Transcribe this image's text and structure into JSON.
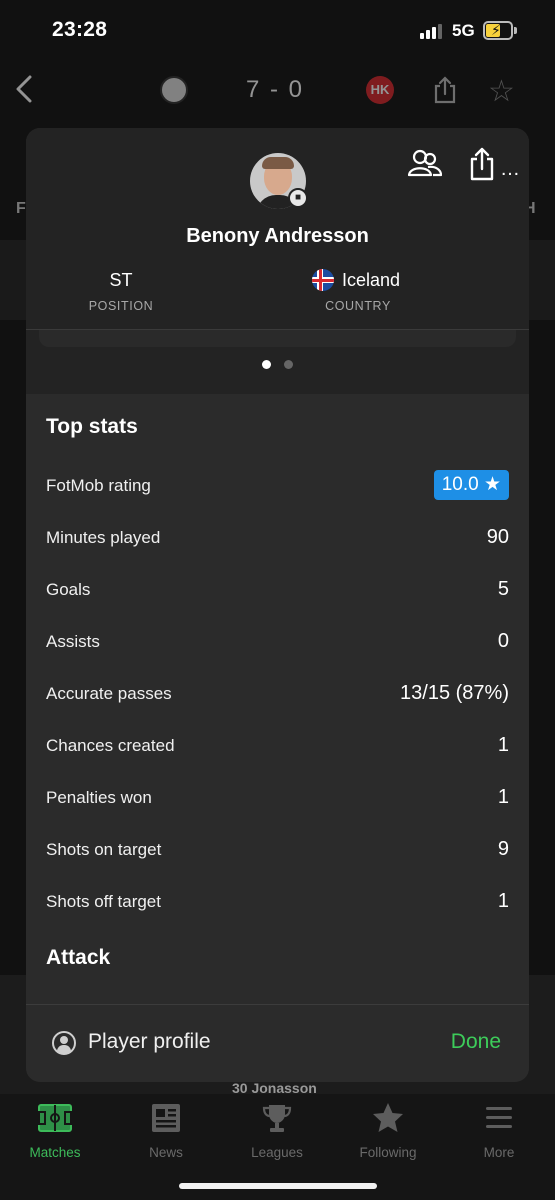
{
  "status_bar": {
    "time": "23:28",
    "network": "5G",
    "battery_icon": "battery-charging-icon"
  },
  "match_header": {
    "score": "7 - 0",
    "away_badge": "HK",
    "side_left": "F",
    "side_right": "H",
    "background_player": "30 Jonasson"
  },
  "player": {
    "name": "Benony Andresson",
    "position_value": "ST",
    "position_label": "POSITION",
    "country_value": "Iceland",
    "country_label": "COUNTRY"
  },
  "top_stats": {
    "title": "Top stats",
    "rows": [
      {
        "label": "FotMob rating",
        "value": "10.0 ★"
      },
      {
        "label": "Minutes played",
        "value": "90"
      },
      {
        "label": "Goals",
        "value": "5"
      },
      {
        "label": "Assists",
        "value": "0"
      },
      {
        "label": "Accurate passes",
        "value": "13/15 (87%)"
      },
      {
        "label": "Chances created",
        "value": "1"
      },
      {
        "label": "Penalties won",
        "value": "1"
      },
      {
        "label": "Shots on target",
        "value": "9"
      },
      {
        "label": "Shots off target",
        "value": "1"
      }
    ]
  },
  "attack": {
    "title": "Attack"
  },
  "footer": {
    "profile_label": "Player profile",
    "done_label": "Done"
  },
  "tabbar": {
    "items": [
      {
        "label": "Matches",
        "icon": "pitch-icon",
        "active": true
      },
      {
        "label": "News",
        "icon": "newspaper-icon",
        "active": false
      },
      {
        "label": "Leagues",
        "icon": "trophy-icon",
        "active": false
      },
      {
        "label": "Following",
        "icon": "star-icon",
        "active": false
      },
      {
        "label": "More",
        "icon": "menu-icon",
        "active": false
      }
    ]
  },
  "colors": {
    "accent_green": "#3dcc5a",
    "rating_blue": "#1e8fe6",
    "card_bg": "#2b2b2b"
  }
}
